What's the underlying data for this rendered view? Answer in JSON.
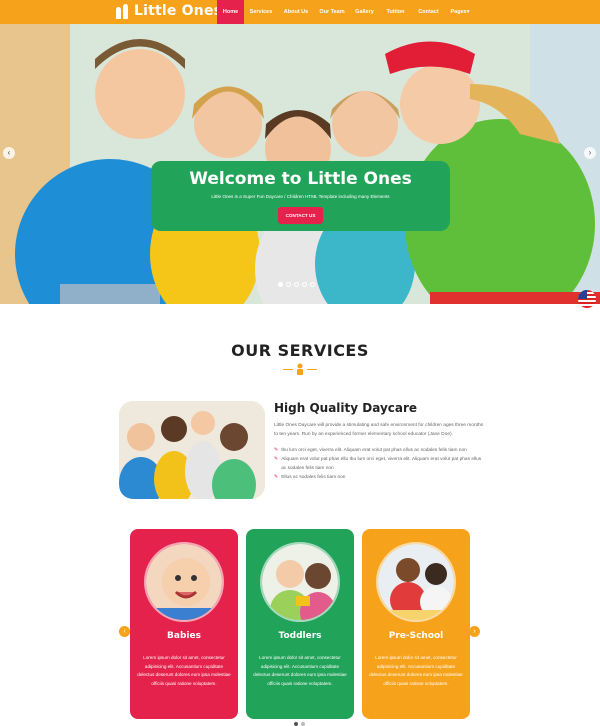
{
  "brand": {
    "name": "Little Ones"
  },
  "nav": {
    "items": [
      {
        "label": "Home"
      },
      {
        "label": "Services"
      },
      {
        "label": "About Us"
      },
      {
        "label": "Our Team"
      },
      {
        "label": "Gallery"
      },
      {
        "label": "Tuition"
      },
      {
        "label": "Contact"
      },
      {
        "label": "Pages▾"
      }
    ],
    "active_color": "#e5224b",
    "bar_color": "#f7a21b"
  },
  "hero": {
    "title": "Welcome to Little Ones",
    "subtitle": "Little Ones is a Super Fun Daycare / Children HTML Template including many Elements",
    "cta": "CONTACT US",
    "slides": 5,
    "active_slide": 1
  },
  "services": {
    "heading": "OUR SERVICES",
    "feature": {
      "title": "High Quality Daycare",
      "description": "Little Ones Daycare will provide a stimulating and safe environment for children ages three months to ten years. Run by an experienced former elementary school educator (Jane Doe).",
      "bullets": [
        "Ibu lum orci eget, viverra elit. Aliquam erat volut pat phas ellus ac sodales felis tiam non",
        "Aliquam erat volut pat phas ellu Ibu lum orci eget, viverra elit. Aliquam erat volut pat phas ellus ac sodales felis tiam non",
        "Ellus ac sodales felis tiam non"
      ]
    },
    "cards": [
      {
        "title": "Babies",
        "color": "#e5224b",
        "text": "Lorem ipsum dolor sit amet, consectetur adipisicing elit. Accusantium cupiditate delectus deserunt dolores eum ipsa molestiae officiis quasi ratione voluptatem."
      },
      {
        "title": "Toddlers",
        "color": "#22a35a",
        "text": "Lorem ipsum dolor sit amet, consectetur adipisicing elit. Accusantium cupiditate delectus deserunt dolores eum ipsa molestiae officiis quasi ratione voluptatem."
      },
      {
        "title": "Pre-School",
        "color": "#f7a21b",
        "text": "Lorem ipsum dolor sit amet, consectetur adipisicing elit. Accusantium cupiditate delectus deserunt dolores eum ipsa molestiae officiis quasi ratione voluptatem."
      }
    ]
  },
  "icons": {
    "hero_prev": "chevron-left-icon",
    "hero_next": "chevron-right-icon",
    "language": "us-flag-icon",
    "bullet": "pencil-icon",
    "cards_prev": "chevron-left-icon",
    "cards_next": "chevron-right-icon"
  }
}
